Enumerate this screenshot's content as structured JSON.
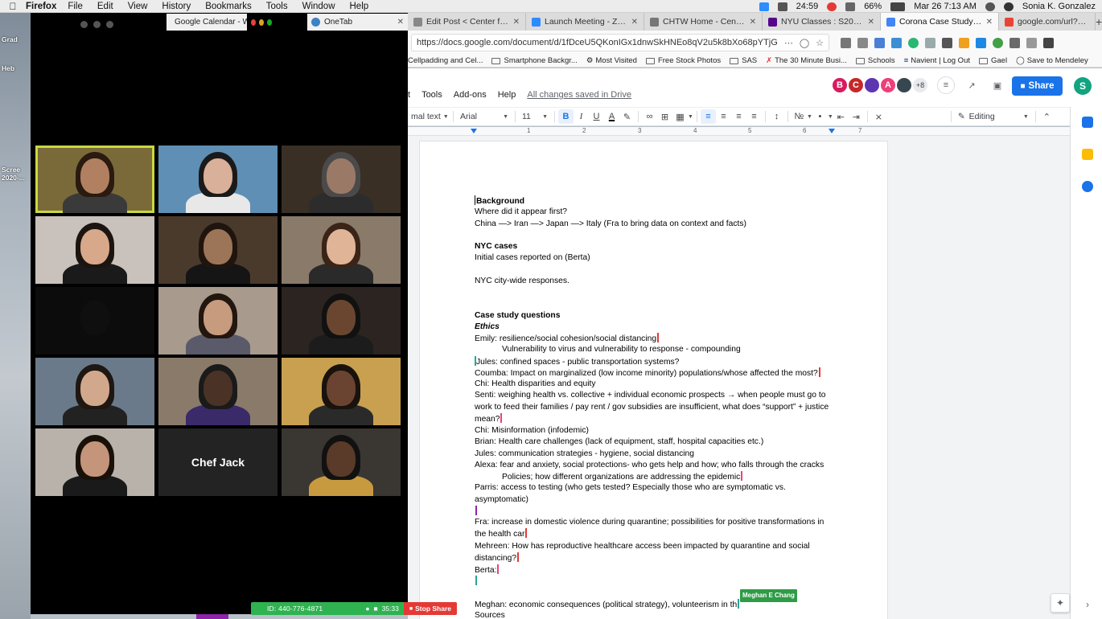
{
  "menubar": {
    "app_name": "Firefox",
    "menus": [
      "File",
      "Edit",
      "View",
      "History",
      "Bookmarks",
      "Tools",
      "Window",
      "Help"
    ],
    "clock": "Mar 26  7:13 AM",
    "battery": "66%",
    "timer": "24:59",
    "user": "Sonia K. Gonzalez"
  },
  "desktop": {
    "labels": [
      "Grad",
      "Heb",
      "Scree",
      "2020-..."
    ]
  },
  "tabs": [
    {
      "title": "Google Calendar - W",
      "color": "#4285f4"
    },
    {
      "title": "OneTab",
      "color": "#3b82c4"
    },
    {
      "title": "Edit Post < Center for Hu",
      "color": "#888888"
    },
    {
      "title": "Launch Meeting - Zoom",
      "color": "#2d8cff"
    },
    {
      "title": "CHTW Home - Center f",
      "color": "#777777"
    },
    {
      "title": "NYU Classes : S2020, T",
      "color": "#57068c"
    },
    {
      "title": "Corona Case Study - Go",
      "color": "#4285f4",
      "active": true
    },
    {
      "title": "google.com/url?sa=t&rc",
      "color": "#ea4335"
    }
  ],
  "urlbar": {
    "url": "https://docs.google.com/document/d/1fDceU5QKonIGx1dnwSkHNEo8qV2u5k8bXo68pYTjGA/edit"
  },
  "bookmarks": [
    "Cellpadding and Cel...",
    "Smartphone Backgr...",
    "Most Visited",
    "Free Stock Photos",
    "SAS",
    "The 30 Minute Busi...",
    "Schools",
    "Navient | Log Out",
    "Gael",
    "Save to Mendeley"
  ],
  "docs": {
    "menus": [
      "t",
      "Tools",
      "Add-ons",
      "Help"
    ],
    "saved_status": "All changes saved in Drive",
    "avatars": [
      {
        "letter": "B",
        "color": "#d81b60"
      },
      {
        "letter": "C",
        "color": "#c62828"
      },
      {
        "letter": "",
        "color": "#5e35b1"
      },
      {
        "letter": "A",
        "color": "#ec407a"
      },
      {
        "letter": "",
        "color": "#37474f"
      }
    ],
    "avatar_more": "+8",
    "share_label": "Share",
    "user_initial": "S",
    "toolbar": {
      "style": "mal text",
      "font": "Arial",
      "size": "11",
      "mode": "Editing"
    },
    "ruler_numbers": [
      "1",
      "2",
      "3",
      "4",
      "5",
      "6",
      "7"
    ]
  },
  "document": {
    "lines": [
      {
        "text": "Background",
        "style": "b"
      },
      {
        "text": "Where did it appear first?"
      },
      {
        "text": "China —> Iran —> Japan —> Italy (Fra to bring data on context and facts)"
      },
      {
        "text": "",
        "style": "blank"
      },
      {
        "text": "NYC cases",
        "style": "b"
      },
      {
        "text": "Initial cases reported on (Berta)"
      },
      {
        "text": "",
        "style": "blank"
      },
      {
        "text": "NYC city-wide responses."
      },
      {
        "text": "",
        "style": "blank"
      },
      {
        "text": "",
        "style": "blank"
      },
      {
        "text": "Case study questions",
        "style": "b"
      },
      {
        "text": "Ethics",
        "style": "bi"
      },
      {
        "text": "Emily: resilience/social cohesion/social distancing",
        "cursor": "red"
      },
      {
        "text": "Vulnerability to virus and vulnerability to response - compounding",
        "style": "ind"
      },
      {
        "text": "Jules: confined spaces - public transportation systems?",
        "cursor_before": "teal"
      },
      {
        "text": "Coumba: Impact on marginalized (low income minority) populations/whose affected the most?",
        "cursor": "red"
      },
      {
        "text": "Chi: Health disparities and equity"
      },
      {
        "text": "Senti: weighing health vs. collective + individual economic prospects → when people must go to work to feed their families / pay rent / gov subsidies are insufficient, what does “support” + justice mean?",
        "style": "wrap",
        "cursor": "pink"
      },
      {
        "text": "Chi: Misinformation (infodemic)"
      },
      {
        "text": "Brian: Health care challenges (lack of equipment, staff, hospital capacities etc.)"
      },
      {
        "text": "Jules: communication strategies - hygiene, social distancing"
      },
      {
        "text": "Alexa: fear and anxiety, social protections- who gets help and how; who falls through the cracks"
      },
      {
        "text": "Policies; how different organizations are addressing the epidemic",
        "style": "ind",
        "cursor": "pink"
      },
      {
        "text": "Parris: access to testing (who gets tested? Especially those who are symptomatic vs. asymptomatic)",
        "style": "wrap"
      },
      {
        "text": "",
        "style": "blank",
        "cursor": "purple"
      },
      {
        "text": "Fra: increase in domestic violence during quarantine; possibilities for positive transformations in the health car",
        "style": "wrap",
        "cursor": "red"
      },
      {
        "text": "Mehreen: How has reproductive healthcare access been impacted by quarantine and social distancing?",
        "style": "wrap",
        "cursor": "red"
      },
      {
        "text": "Berta:",
        "cursor": "pink"
      },
      {
        "text": "",
        "style": "blank",
        "cursor": "teal"
      },
      {
        "text": "",
        "style": "blank"
      },
      {
        "text": "Meghan: economic consequences (political strategy), volunteerism in th",
        "cursor": "green",
        "flag": "Meghan E Chang"
      },
      {
        "text": "Sources"
      }
    ]
  },
  "zoom": {
    "tiles": [
      {
        "bg": "#7a6a3a",
        "skin": "#b08060",
        "hair": "#2a1a10",
        "body": "#3a3a3a",
        "speaking": true
      },
      {
        "bg": "#5f8fb4",
        "skin": "#d9b099",
        "hair": "#1a1a1a",
        "body": "#e8e8e8"
      },
      {
        "bg": "#3a2f25",
        "skin": "#9a7a66",
        "hair": "#4a4a4a",
        "body": "#2c2c2c"
      },
      {
        "bg": "#c9c2bc",
        "skin": "#d7a88a",
        "hair": "#1c1410",
        "body": "#1a1a1a"
      },
      {
        "bg": "#4a3a2c",
        "skin": "#9c7458",
        "hair": "#1f150e",
        "body": "#151515"
      },
      {
        "bg": "#8a7a6a",
        "skin": "#e0b496",
        "hair": "#3a2418",
        "body": "#2a2a2a"
      },
      {
        "bg": "#0c0c0c",
        "skin": "#0f0f0f",
        "hair": "#0c0c0c",
        "body": "#0c0c0c"
      },
      {
        "bg": "#a89a8c",
        "skin": "#c79b7e",
        "hair": "#22160f",
        "body": "#5a5a6a"
      },
      {
        "bg": "#2c2420",
        "skin": "#6a4630",
        "hair": "#111111",
        "body": "#1c1c1c"
      },
      {
        "bg": "#6a7a8a",
        "skin": "#d2a88c",
        "hair": "#1e1712",
        "body": "#222222"
      },
      {
        "bg": "#8a7a6a",
        "skin": "#4a3226",
        "hair": "#1a1a1a",
        "body": "#3a2a6a"
      },
      {
        "bg": "#c8a050",
        "skin": "#6a4431",
        "hair": "#1a120c",
        "body": "#2a2a2a"
      },
      {
        "bg": "#b8b2aa",
        "skin": "#c4957a",
        "hair": "#1a100a",
        "body": "#1a1a1a"
      },
      {
        "name": "Chef Jack"
      },
      {
        "bg": "#3a3632",
        "skin": "#5a3a28",
        "hair": "#111111",
        "body": "#c89a40"
      }
    ],
    "meeting_id": "ID: 440-776-4871",
    "elapsed": "35:33",
    "stop_share_label": "Stop Share"
  }
}
